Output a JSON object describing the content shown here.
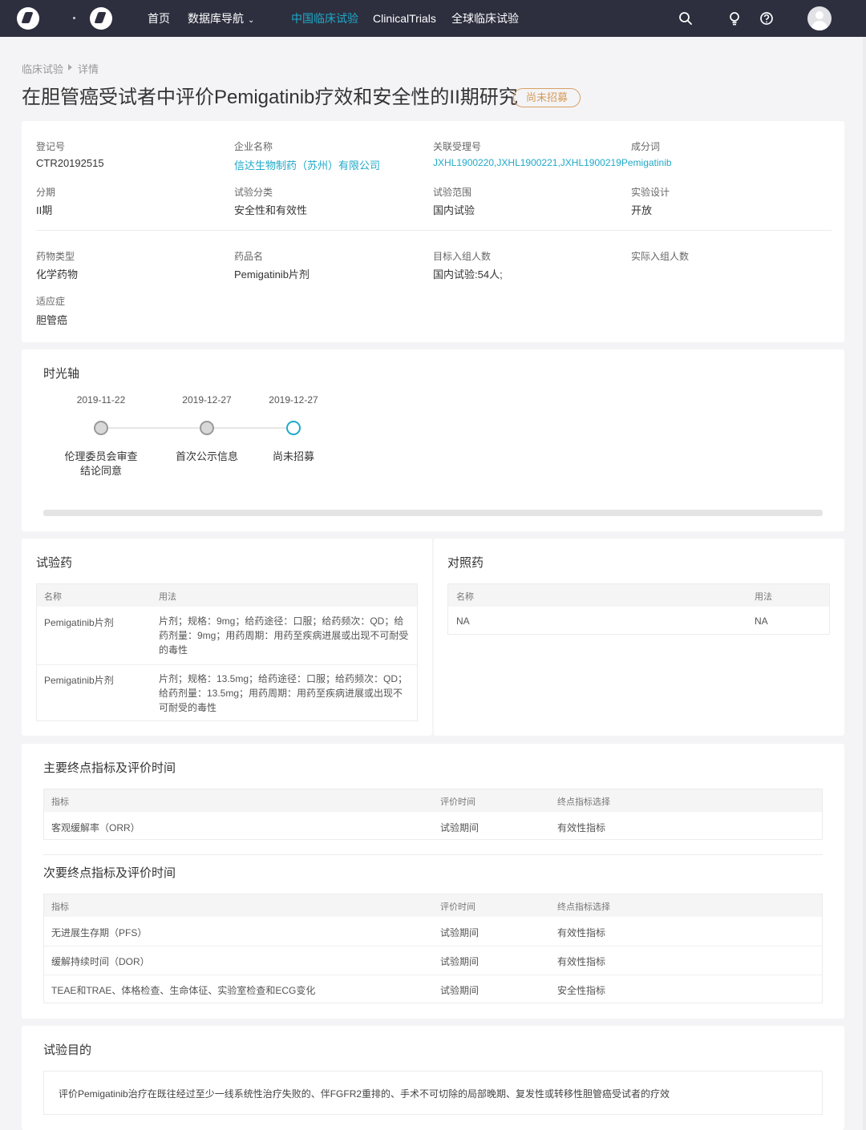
{
  "nav": {
    "home": "首页",
    "db_nav": "数据库导航",
    "cn_trials": "中国临床试验",
    "clinicaltrials": "ClinicalTrials",
    "global_trials": "全球临床试验"
  },
  "breadcrumb": {
    "root": "临床试验",
    "current": "详情"
  },
  "title": "在胆管癌受试者中评价Pemigatinib疗效和安全性的II期研究",
  "status_badge": "尚未招募",
  "info": {
    "reg_no_label": "登记号",
    "reg_no": "CTR20192515",
    "company_label": "企业名称",
    "company": "信达生物制药（苏州）有限公司",
    "acceptance_label": "关联受理号",
    "acceptance": "JXHL1900220,JXHL1900221,JXHL1900219",
    "ingredient_label": "成分词",
    "ingredient": "Pemigatinib",
    "phase_label": "分期",
    "phase": "II期",
    "category_label": "试验分类",
    "category": "安全性和有效性",
    "scope_label": "试验范围",
    "scope": "国内试验",
    "design_label": "实验设计",
    "design": "开放",
    "drug_type_label": "药物类型",
    "drug_type": "化学药物",
    "drug_name_label": "药品名",
    "drug_name": "Pemigatinib片剂",
    "target_enroll_label": "目标入组人数",
    "target_enroll": "国内试验:54人;",
    "actual_enroll_label": "实际入组人数",
    "indication_label": "适应症",
    "indication": "胆管癌"
  },
  "timeline": {
    "title": "时光轴",
    "events": [
      {
        "date": "2019-11-22",
        "label_line1": "伦理委员会审查",
        "label_line2": "结论同意"
      },
      {
        "date": "2019-12-27",
        "label_line1": "首次公示信息",
        "label_line2": ""
      },
      {
        "date": "2019-12-27",
        "label_line1": "尚未招募",
        "label_line2": ""
      }
    ]
  },
  "test_drug": {
    "title": "试验药",
    "col_name": "名称",
    "col_usage": "用法",
    "rows": [
      {
        "name": "Pemigatinib片剂",
        "usage": "片剂；规格：9mg；给药途径：口服；给药频次：QD；给药剂量：9mg；用药周期：用药至疾病进展或出现不可耐受的毒性"
      },
      {
        "name": "Pemigatinib片剂",
        "usage": "片剂；规格：13.5mg；给药途径：口服；给药频次：QD；给药剂量：13.5mg；用药周期：用药至疾病进展或出现不可耐受的毒性"
      }
    ]
  },
  "control_drug": {
    "title": "对照药",
    "col_name": "名称",
    "col_usage": "用法",
    "rows": [
      {
        "name": "NA",
        "usage": "NA"
      }
    ]
  },
  "primary": {
    "title": "主要终点指标及评价时间",
    "col_indicator": "指标",
    "col_time": "评价时间",
    "col_type": "终点指标选择",
    "rows": [
      {
        "indicator": "客观缓解率（ORR）",
        "time": "试验期间",
        "type": "有效性指标"
      }
    ]
  },
  "secondary": {
    "title": "次要终点指标及评价时间",
    "col_indicator": "指标",
    "col_time": "评价时间",
    "col_type": "终点指标选择",
    "rows": [
      {
        "indicator": "无进展生存期（PFS）",
        "time": "试验期间",
        "type": "有效性指标"
      },
      {
        "indicator": "缓解持续时间（DOR）",
        "time": "试验期间",
        "type": "有效性指标"
      },
      {
        "indicator": "TEAE和TRAE、体格检查、生命体征、实验室检查和ECG变化",
        "time": "试验期间",
        "type": "安全性指标"
      }
    ]
  },
  "purpose": {
    "title": "试验目的",
    "text": "评价Pemigatinib治疗在既往经过至少一线系统性治疗失败的、伴FGFR2重排的、手术不可切除的局部晚期、复发性或转移性胆管癌受试者的疗效"
  }
}
